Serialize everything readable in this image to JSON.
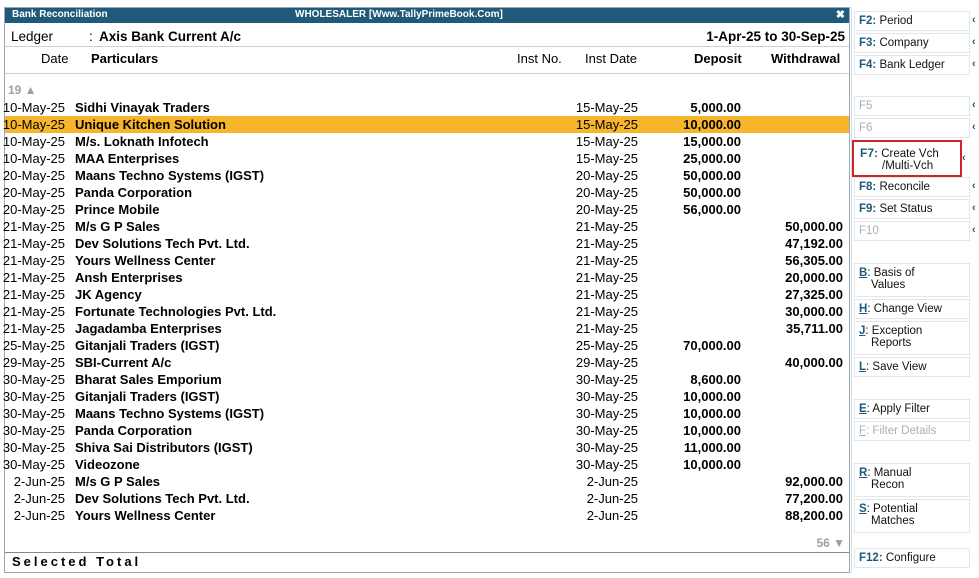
{
  "window": {
    "title": "Bank Reconciliation",
    "company": "WHOLESALER [Www.TallyPrimeBook.Com]",
    "close": "✖"
  },
  "ledger": {
    "label": "Ledger",
    "colon": ":",
    "name": "Axis Bank Current A/c",
    "period": "1-Apr-25 to 30-Sep-25"
  },
  "columns": {
    "date": "Date",
    "particulars": "Particulars",
    "inst_no": "Inst No.",
    "inst_date": "Inst Date",
    "deposit": "Deposit",
    "withdrawal": "Withdrawal"
  },
  "count_above": "19 ▲",
  "count_below": "56 ▼",
  "rows": [
    {
      "date": "10-May-25",
      "particulars": "Sidhi Vinayak Traders",
      "inst_date": "15-May-25",
      "deposit": "5,000.00",
      "withdrawal": ""
    },
    {
      "date": "10-May-25",
      "particulars": "Unique Kitchen Solution",
      "inst_date": "15-May-25",
      "deposit": "10,000.00",
      "withdrawal": ""
    },
    {
      "date": "10-May-25",
      "particulars": "M/s. Loknath Infotech",
      "inst_date": "15-May-25",
      "deposit": "15,000.00",
      "withdrawal": ""
    },
    {
      "date": "10-May-25",
      "particulars": "MAA Enterprises",
      "inst_date": "15-May-25",
      "deposit": "25,000.00",
      "withdrawal": ""
    },
    {
      "date": "20-May-25",
      "particulars": "Maans Techno Systems (IGST)",
      "inst_date": "20-May-25",
      "deposit": "50,000.00",
      "withdrawal": ""
    },
    {
      "date": "20-May-25",
      "particulars": "Panda Corporation",
      "inst_date": "20-May-25",
      "deposit": "50,000.00",
      "withdrawal": ""
    },
    {
      "date": "20-May-25",
      "particulars": "Prince Mobile",
      "inst_date": "20-May-25",
      "deposit": "56,000.00",
      "withdrawal": ""
    },
    {
      "date": "21-May-25",
      "particulars": "M/s G P Sales",
      "inst_date": "21-May-25",
      "deposit": "",
      "withdrawal": "50,000.00"
    },
    {
      "date": "21-May-25",
      "particulars": "Dev Solutions Tech Pvt. Ltd.",
      "inst_date": "21-May-25",
      "deposit": "",
      "withdrawal": "47,192.00"
    },
    {
      "date": "21-May-25",
      "particulars": "Yours Wellness Center",
      "inst_date": "21-May-25",
      "deposit": "",
      "withdrawal": "56,305.00"
    },
    {
      "date": "21-May-25",
      "particulars": "Ansh Enterprises",
      "inst_date": "21-May-25",
      "deposit": "",
      "withdrawal": "20,000.00"
    },
    {
      "date": "21-May-25",
      "particulars": "JK Agency",
      "inst_date": "21-May-25",
      "deposit": "",
      "withdrawal": "27,325.00"
    },
    {
      "date": "21-May-25",
      "particulars": "Fortunate Technologies Pvt. Ltd.",
      "inst_date": "21-May-25",
      "deposit": "",
      "withdrawal": "30,000.00"
    },
    {
      "date": "21-May-25",
      "particulars": "Jagadamba Enterprises",
      "inst_date": "21-May-25",
      "deposit": "",
      "withdrawal": "35,711.00"
    },
    {
      "date": "25-May-25",
      "particulars": "Gitanjali Traders (IGST)",
      "inst_date": "25-May-25",
      "deposit": "70,000.00",
      "withdrawal": ""
    },
    {
      "date": "29-May-25",
      "particulars": "SBI-Current A/c",
      "inst_date": "29-May-25",
      "deposit": "",
      "withdrawal": "40,000.00"
    },
    {
      "date": "30-May-25",
      "particulars": "Bharat Sales Emporium",
      "inst_date": "30-May-25",
      "deposit": "8,600.00",
      "withdrawal": ""
    },
    {
      "date": "30-May-25",
      "particulars": "Gitanjali Traders (IGST)",
      "inst_date": "30-May-25",
      "deposit": "10,000.00",
      "withdrawal": ""
    },
    {
      "date": "30-May-25",
      "particulars": "Maans Techno Systems (IGST)",
      "inst_date": "30-May-25",
      "deposit": "10,000.00",
      "withdrawal": ""
    },
    {
      "date": "30-May-25",
      "particulars": "Panda Corporation",
      "inst_date": "30-May-25",
      "deposit": "10,000.00",
      "withdrawal": ""
    },
    {
      "date": "30-May-25",
      "particulars": "Shiva Sai Distributors (IGST)",
      "inst_date": "30-May-25",
      "deposit": "11,000.00",
      "withdrawal": ""
    },
    {
      "date": "30-May-25",
      "particulars": "Videozone",
      "inst_date": "30-May-25",
      "deposit": "10,000.00",
      "withdrawal": ""
    },
    {
      "date": "2-Jun-25",
      "particulars": "M/s G P Sales",
      "inst_date": "2-Jun-25",
      "deposit": "",
      "withdrawal": "92,000.00"
    },
    {
      "date": "2-Jun-25",
      "particulars": "Dev Solutions Tech Pvt. Ltd.",
      "inst_date": "2-Jun-25",
      "deposit": "",
      "withdrawal": "77,200.00"
    },
    {
      "date": "2-Jun-25",
      "particulars": "Yours Wellness Center",
      "inst_date": "2-Jun-25",
      "deposit": "",
      "withdrawal": "88,200.00"
    }
  ],
  "selected_row": 1,
  "footer": {
    "label": "Selected Total"
  },
  "sidebar": {
    "f2_key": "F2:",
    "f2_label": "Period",
    "f3_key": "F3:",
    "f3_label": "Company",
    "f4_key": "F4:",
    "f4_label": "Bank Ledger",
    "f5_key": "F5",
    "f6_key": "F6",
    "f7_key": "F7:",
    "f7_label_line1": "Create Vch",
    "f7_label_line2": "/Multi-Vch",
    "f8_key": "F8:",
    "f8_label": "Reconcile",
    "f9_key": "F9:",
    "f9_label": "Set Status",
    "f10_key": "F10",
    "b_key": "B",
    "b_label_line1": ": Basis of",
    "b_label_line2": "Values",
    "h_key": "H",
    "h_label": ": Change View",
    "j_key": "J",
    "j_label_line1": ": Exception",
    "j_label_line2": "Reports",
    "l_key": "L",
    "l_label": ": Save View",
    "e_key": "E",
    "e_label": ": Apply Filter",
    "f_key": "F",
    "f_label": ": Filter Details",
    "r_key": "R",
    "r_label_line1": ": Manual",
    "r_label_line2": "Recon",
    "s_key": "S",
    "s_label_line1": ": Potential",
    "s_label_line2": "Matches",
    "f12_key": "F12:",
    "f12_label": "Configure",
    "arrow": "‹"
  },
  "colors": {
    "title_bar": "#1f5a7a",
    "selected_row": "#f7b52c",
    "highlight_box": "#d2232a",
    "key_text": "#1f5a7a"
  }
}
